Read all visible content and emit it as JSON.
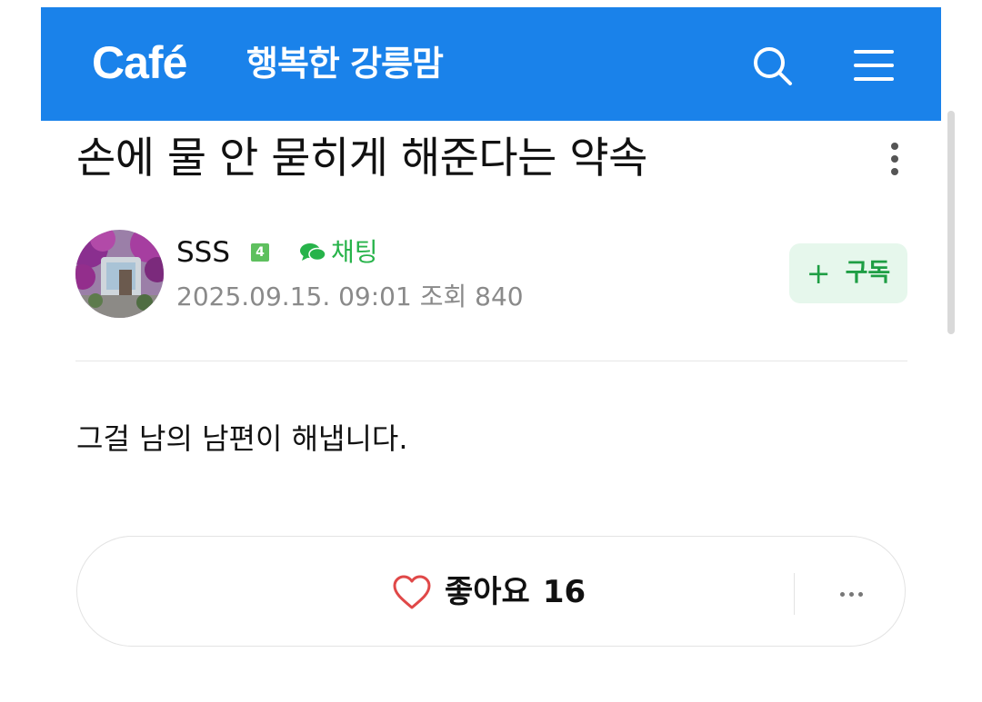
{
  "header": {
    "logo": "Café",
    "cafe_name": "행복한 강릉맘",
    "background": "#1a82ea",
    "search_icon": "search-icon",
    "menu_icon": "menu-icon"
  },
  "post": {
    "title": "손에 물 안 묻히게 해준다는 약속",
    "more_icon": "more-vertical-icon",
    "author": {
      "name": "SSS",
      "level": "4",
      "chat_label": "채팅",
      "chat_icon": "chat-bubble-icon"
    },
    "meta": "2025.09.15. 09:01 조회 840",
    "subscribe": {
      "plus": "+",
      "label": "구독"
    },
    "body": "그걸 남의 남편이 해냅니다."
  },
  "reactions": {
    "like_label": "좋아요",
    "like_count": "16",
    "like_icon": "heart-icon",
    "more_icon": "more-horizontal-icon"
  },
  "colors": {
    "brand_blue": "#1a82ea",
    "chat_green": "#27b34a",
    "subscribe_bg": "#e6f7ec",
    "subscribe_fg": "#1e9e44",
    "heart": "#e04848",
    "meta_gray": "#8a8a8a"
  }
}
